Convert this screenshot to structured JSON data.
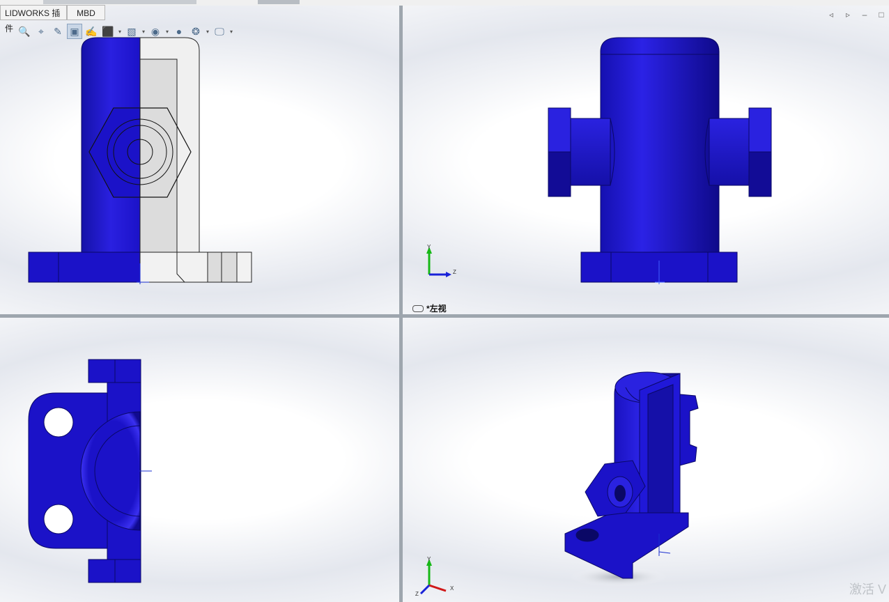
{
  "tabs": [
    {
      "label": "LIDWORKS 插件"
    },
    {
      "label": "MBD"
    }
  ],
  "toolbar": {
    "icons": [
      "zoom-to-fit-icon",
      "zoom-area-icon",
      "previous-view-icon",
      "section-view-icon",
      "dynamic-annotation-icon",
      "view-orientation-icon",
      "display-style-icon",
      "hide-show-items-icon",
      "edit-appearance-icon",
      "apply-scene-icon",
      "view-settings-icon"
    ]
  },
  "viewports": {
    "top_right": {
      "label": "*左视",
      "axis_y": "Y",
      "axis_z": "Z"
    },
    "bottom_right": {
      "axis_y": "Y",
      "axis_x": "X",
      "axis_z": "Z"
    }
  },
  "colors": {
    "part": "#1b12c8",
    "part_dark": "#0f0a8a",
    "section_fill": "#ececec",
    "background": "#ffffff"
  },
  "watermark": "激活 V"
}
